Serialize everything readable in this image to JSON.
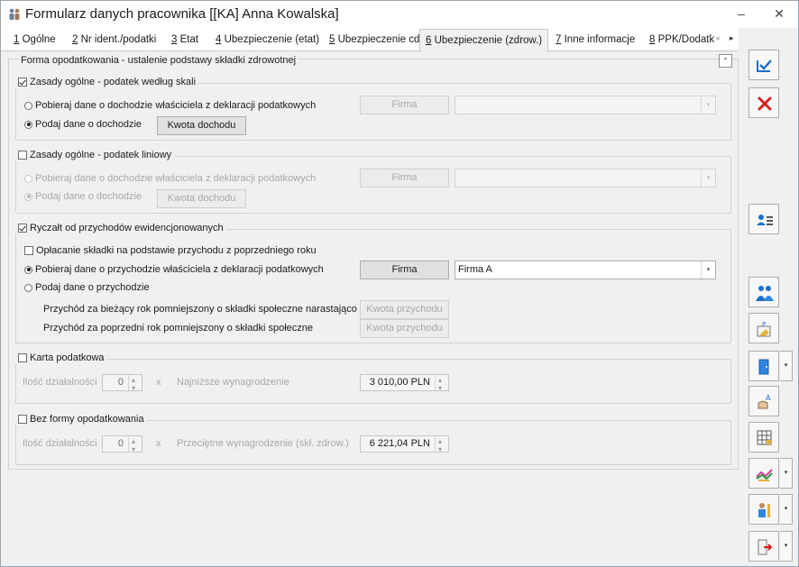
{
  "window": {
    "title": "Formularz danych pracownika [[KA] Anna Kowalska]",
    "minimize": "–",
    "close": "✕"
  },
  "tabs": [
    {
      "num": "1",
      "label": " Ogólne"
    },
    {
      "num": "2",
      "label": " Nr ident./podatki"
    },
    {
      "num": "3",
      "label": " Etat"
    },
    {
      "num": "4",
      "label": " Ubezpieczenie (etat)"
    },
    {
      "num": "5",
      "label": " Ubezpieczenie cd"
    },
    {
      "num": "6",
      "label": " Ubezpieczenie (zdrow.)"
    },
    {
      "num": "7",
      "label": " Inne informacje"
    },
    {
      "num": "8",
      "label": " PPK/Dodatk"
    }
  ],
  "tab_scroll": {
    "left": "◂",
    "right": "▸"
  },
  "panel": {
    "title": "Forma opodatkowania - ustalenie podstawy składki zdrowotnej",
    "collapse": "⌃"
  },
  "skala": {
    "legend": "Zasady ogólne - podatek według skali",
    "opt1": "Pobieraj dane o dochodzie właściciela z deklaracji podatkowych",
    "opt2": "Podaj dane o dochodzie",
    "firma_btn": "Firma",
    "kwota_btn": "Kwota dochodu",
    "combo_value": ""
  },
  "liniowy": {
    "legend": "Zasady ogólne - podatek liniowy",
    "opt1": "Pobieraj dane o dochodzie właściciela z deklaracji podatkowych",
    "opt2": "Podaj dane o dochodzie",
    "firma_btn": "Firma",
    "kwota_btn": "Kwota dochodu",
    "combo_value": ""
  },
  "ryczalt": {
    "legend": "Ryczałt od przychodów ewidencjonowanych",
    "opt0": "Opłacanie składki na podstawie przychodu z poprzedniego roku",
    "opt1": "Pobieraj dane o przychodzie właściciela z deklaracji podatkowych",
    "opt2": "Podaj dane o przychodzie",
    "firma_btn": "Firma",
    "combo_value": "Firma A",
    "row1_label": "Przychód za bieżący rok pomniejszony o składki społeczne narastająco",
    "row1_btn": "Kwota przychodu",
    "row2_label": "Przychód za poprzedni rok pomniejszony o składki społeczne",
    "row2_btn": "Kwota przychodu"
  },
  "karta": {
    "legend": "Karta podatkowa",
    "ilosc_label": "Ilość działalności",
    "ilosc_value": "0",
    "x": "x",
    "wyn_label": "Najniższe wynagrodzenie",
    "wyn_value": "3 010,00 PLN"
  },
  "bez_formy": {
    "legend": "Bez formy opodatkowania",
    "ilosc_label": "Ilość działalności",
    "ilosc_value": "0",
    "x": "x",
    "wyn_label": "Przeciętne wynagrodzenie (skł. zdrow.)",
    "wyn_value": "6 221,04 PLN"
  },
  "sidebar": {
    "drop": "▾"
  },
  "colors": {
    "accent_blue": "#1e6fc8",
    "cancel_red": "#d81e1e"
  }
}
